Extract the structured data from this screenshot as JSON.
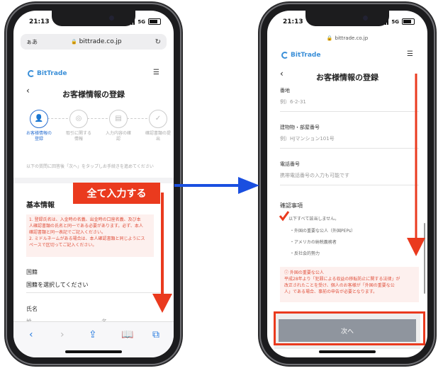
{
  "left_phone": {
    "status": {
      "time": "21:13",
      "network": "5G"
    },
    "browser": {
      "aa_label": "ぁあ",
      "url": "bittrade.co.jp"
    },
    "logo_text": "BitTrade",
    "page_title": "お客様情報の登録",
    "steps": [
      {
        "label": "お客様情報の登録",
        "active": true
      },
      {
        "label": "取引に関する情報",
        "active": false
      },
      {
        "label": "入力内容の確認",
        "active": false
      },
      {
        "label": "確認書類の提出",
        "active": false
      }
    ],
    "hint_text": "以下の質問に回答後「次へ」をタップしお手続きを進めてください",
    "section_title": "基本情報",
    "notice_lines": [
      "1. 登録氏名は、入金時の名義、出金時の口座名義、及び本",
      "人確認書類の氏名と同一である必要があります。必ず、本人",
      "確認書類と同一表記でご記入ください。",
      "2. ミドルネームがある場合は、本人確認書類と同じようにス",
      "ペースで区切ってご記入ください。"
    ],
    "country": {
      "label": "国籍",
      "value": "国籍を選択してください"
    },
    "name": {
      "label": "氏名",
      "last_placeholder": "姓",
      "first_placeholder": "名"
    },
    "callout_text": "全て入力する"
  },
  "right_phone": {
    "status": {
      "time": "21:13",
      "network": "5G"
    },
    "browser": {
      "url": "bittrade.co.jp"
    },
    "logo_text": "BitTrade",
    "page_title": "お客様情報の登録",
    "fields": [
      {
        "label": "番地",
        "placeholder": "例）6-2-31"
      },
      {
        "label": "建物物・部屋番号",
        "placeholder": "例）HJマンション101号"
      },
      {
        "label": "電話番号",
        "placeholder": "携帯電話番号の入力も可能です"
      }
    ],
    "confirm": {
      "title": "確認事項",
      "checkbox_label": "以下すべて該当しません。",
      "items": [
        "外国の重要な公人（外国PEPs）",
        "アメリカの納税義務者",
        "反社会的勢力"
      ]
    },
    "warning": {
      "title": "外国の重要な公人",
      "line1": "平成28年より「犯罪による収益の移転防止に関する法律」が",
      "line2": "改正されたことを受け、個人のお客様が「外国の重要な公",
      "line3": "人」である場合、事前の申告が必要となります。"
    },
    "next_button": "次へ"
  },
  "colors": {
    "accent_red": "#ea3a1e",
    "arrow_blue": "#1a4fe0",
    "brand_blue": "#3a8fd8"
  }
}
